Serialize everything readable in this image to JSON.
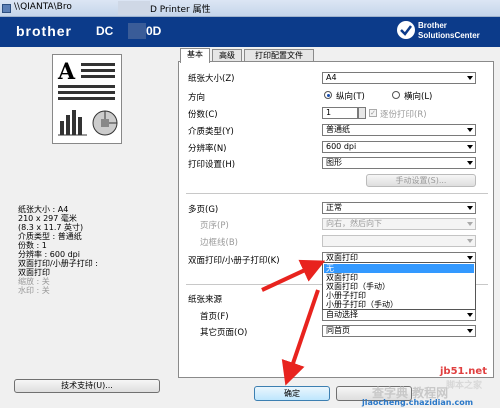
{
  "window": {
    "title_prefix": "\\\\QIANTA\\Bro",
    "title_suffix": "D Printer 属性"
  },
  "banner": {
    "logo": "brother",
    "model_prefix": "DC",
    "model_suffix": "0D",
    "solutions_line1": "Brother",
    "solutions_line2": "SolutionsCenter",
    "bg_color": "#0c3b8a"
  },
  "summary": {
    "lines": [
      "纸张大小 : A4",
      "210 x 297 毫米",
      "(8.3 x 11.7 英寸)",
      "介质类型 : 普通纸",
      "份数 : 1",
      "分辨率 : 600 dpi",
      "双面打印/小册子打印 :",
      "双面打印"
    ],
    "disabled_lines": [
      "缩放 : 关",
      "水印 : 关"
    ],
    "support_button": "技术支持(U)..."
  },
  "tabs": [
    "基本",
    "高级",
    "打印配置文件"
  ],
  "basic": {
    "paper_size_label": "纸张大小(Z)",
    "paper_size_value": "A4",
    "orientation_label": "方向",
    "portrait_label": "纵向(T)",
    "landscape_label": "横向(L)",
    "copies_label": "份数(C)",
    "copies_value": "1",
    "collate_label": "逐份打印(R)",
    "media_label": "介质类型(Y)",
    "media_value": "普通纸",
    "resolution_label": "分辨率(N)",
    "resolution_value": "600 dpi",
    "print_settings_label": "打印设置(H)",
    "print_settings_value": "图形",
    "manual_settings_button": "手动设置(S)...",
    "multipage_label": "多页(G)",
    "multipage_value": "正常",
    "page_order_label": "页序(P)",
    "page_order_value": "向右，然后向下",
    "border_label": "边框线(B)",
    "duplex_label": "双面打印/小册子打印(K)",
    "duplex_value": "双面打印",
    "duplex_options": [
      "无",
      "双面打印",
      "双面打印（手动）",
      "小册子打印",
      "小册子打印（手动）"
    ],
    "paper_source_label": "纸张来源",
    "first_page_label": "首页(F)",
    "first_page_value": "自动选择",
    "other_pages_label": "其它页面(O)",
    "other_pages_value": "同首页"
  },
  "footer": {
    "ok_button": "确定"
  },
  "watermark": {
    "site": "jb51.net",
    "brand": "脚本之家",
    "tutorial": "查字典 教程网",
    "url": "jiaocheng.chazidian.com"
  }
}
